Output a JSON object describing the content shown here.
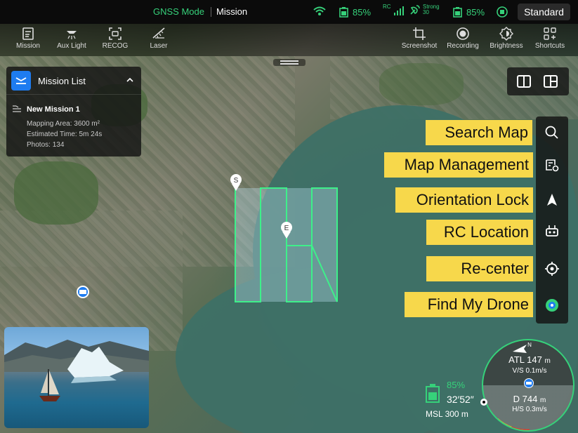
{
  "status_bar": {
    "mode": "GNSS Mode",
    "mission": "Mission",
    "drone_battery": "85%",
    "rc_label": "RC",
    "signal_label": "Strong",
    "signal_value": "30",
    "rc_battery": "85%",
    "standard_button": "Standard"
  },
  "toolbar": {
    "items_left": [
      {
        "label": "Mission",
        "icon": "mission-icon"
      },
      {
        "label": "Aux Light",
        "icon": "aux-light-icon"
      },
      {
        "label": "RECOG",
        "icon": "recog-icon"
      },
      {
        "label": "Laser",
        "icon": "laser-icon"
      }
    ],
    "items_right": [
      {
        "label": "Screenshot",
        "icon": "screenshot-icon"
      },
      {
        "label": "Recording",
        "icon": "recording-icon"
      },
      {
        "label": "Brightness",
        "icon": "brightness-icon"
      },
      {
        "label": "Shortcuts",
        "icon": "shortcuts-icon"
      }
    ]
  },
  "mission_list": {
    "title": "Mission List",
    "mission": {
      "name": "New Mission 1",
      "mapping_area": "Mapping Area: 3600 m²",
      "estimated_time": "Estimated Time: 5m 24s",
      "photos": "Photos: 134"
    }
  },
  "map_tools": [
    {
      "label": "Search Map",
      "icon": "search-icon"
    },
    {
      "label": "Map Management",
      "icon": "map-management-icon"
    },
    {
      "label": "Orientation Lock",
      "icon": "orientation-lock-icon"
    },
    {
      "label": "RC Location",
      "icon": "rc-location-icon"
    },
    {
      "label": "Re-center",
      "icon": "recenter-icon"
    },
    {
      "label": "Find My Drone",
      "icon": "find-my-drone-icon"
    }
  ],
  "route": {
    "start_marker": "S",
    "end_marker": "E"
  },
  "telemetry": {
    "battery_pct": "85%",
    "flight_time": "32′52″",
    "msl": "MSL 300 m",
    "compass_north": "N",
    "atl_label": "ATL",
    "atl_value": "147",
    "atl_unit": "m",
    "vs": "V/S 0.1m/s",
    "distance_label": "D",
    "distance_value": "744",
    "distance_unit": "m",
    "hs": "H/S 0.3m/s"
  },
  "colors": {
    "accent_green": "#36d17a",
    "callout_yellow": "#f7d84b",
    "mission_blue": "#1e7cf0"
  }
}
